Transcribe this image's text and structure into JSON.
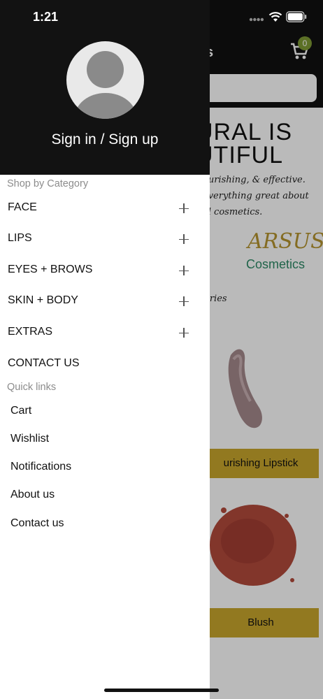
{
  "status_bar": {
    "time": "1:21"
  },
  "background": {
    "header_title_fragment": "s",
    "cart_count": "0",
    "hero_line1": "URAL IS",
    "hero_line2": "UTIFUL",
    "tagline_lines": [
      "ourishing, & effective.",
      "everything great about",
      "al cosmetics."
    ],
    "logo_top": "ARSUS",
    "logo_bottom": "Cosmetics",
    "categories_fragment": "ories",
    "products": [
      {
        "button_label": "urishing Lipstick",
        "swatch_color": "#a58a8d"
      },
      {
        "button_label": "Blush",
        "swatch_color": "#b24a3c"
      }
    ]
  },
  "drawer": {
    "auth_label": "Sign in / Sign up",
    "shop_section_label": "Shop by Category",
    "categories": [
      {
        "label": "FACE",
        "expandable": true
      },
      {
        "label": "LIPS",
        "expandable": true
      },
      {
        "label": "EYES + BROWS",
        "expandable": true
      },
      {
        "label": "SKIN + BODY",
        "expandable": true
      },
      {
        "label": "EXTRAS",
        "expandable": true
      },
      {
        "label": "CONTACT US",
        "expandable": false
      }
    ],
    "quick_links_label": "Quick links",
    "quick_links": [
      "Cart",
      "Wishlist",
      "Notifications",
      "About us",
      "Contact us"
    ]
  },
  "colors": {
    "drawer_header": "#121212",
    "accent_green": "#7f9a35",
    "button_gold": "#c9a62c"
  }
}
